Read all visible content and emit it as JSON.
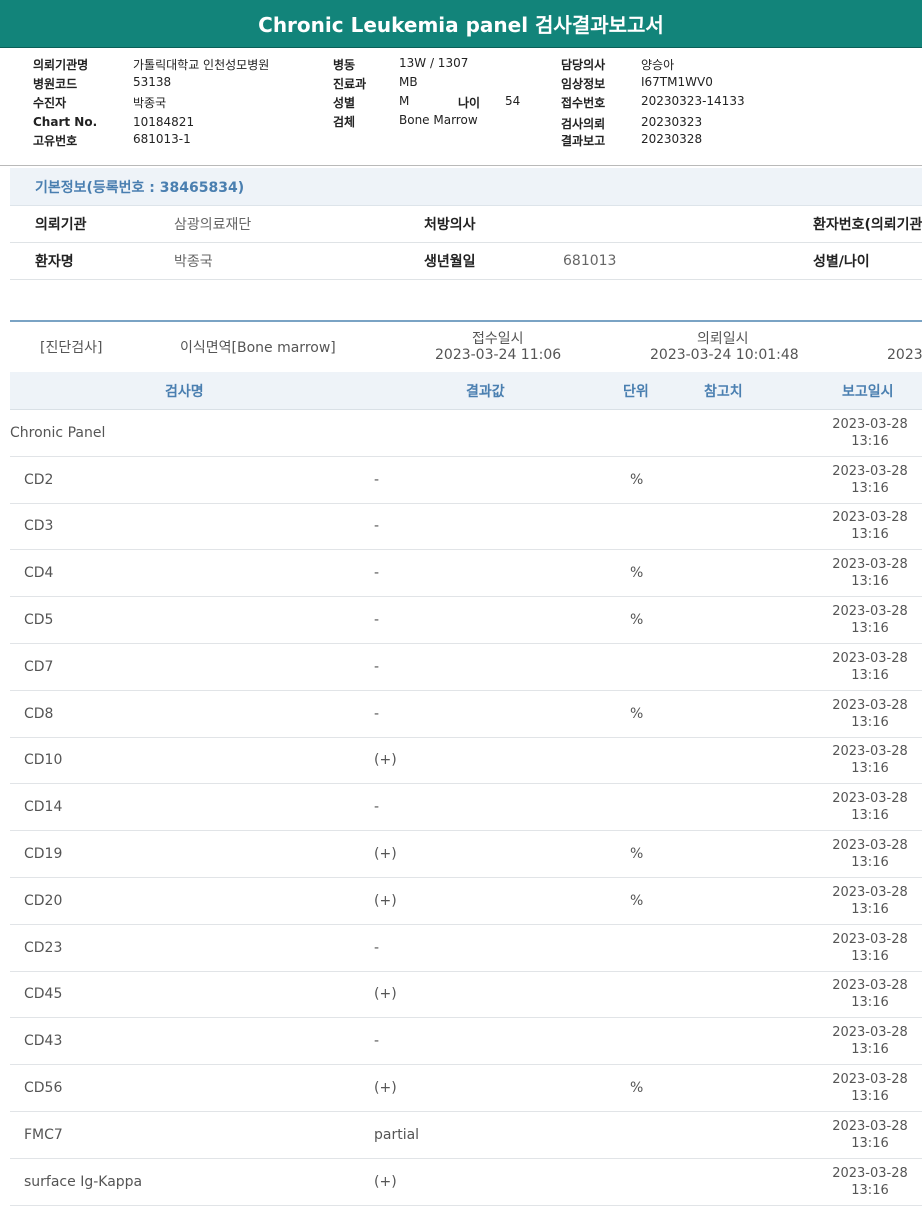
{
  "report": {
    "title": "Chronic Leukemia panel 검사결과보고서"
  },
  "header": {
    "institution_label": "의뢰기관명",
    "institution": "가톨릭대학교 인천성모병원",
    "hospital_code_label": "병원코드",
    "hospital_code": "53138",
    "patient_label": "수진자",
    "patient": "박종국",
    "chart_label": "Chart No.",
    "chart": "10184821",
    "unique_label": "고유번호",
    "unique": "681013-1",
    "ward_label": "병동",
    "ward": "13W / 1307",
    "dept_label": "진료과",
    "dept": "MB",
    "sex_label": "성별",
    "sex": "M",
    "age_label": "나이",
    "age": "54",
    "specimen_label": "검체",
    "specimen": "Bone Marrow",
    "doctor_label": "담당의사",
    "doctor": "양승아",
    "clinical_label": "임상정보",
    "clinical": "I67TM1WV0",
    "receipt_label": "접수번호",
    "receipt": "20230323-14133",
    "request_label": "검사의뢰",
    "request": "20230323",
    "result_label": "결과보고",
    "result": "20230328"
  },
  "basic": {
    "title": "기본정보(등록번호 : 38465834)",
    "row1": {
      "institution_label": "의뢰기관",
      "institution": "삼광의료재단",
      "physician_label": "처방의사",
      "patient_no_label": "환자번호(의뢰기관"
    },
    "row2": {
      "name_label": "환자명",
      "name": "박종국",
      "birth_label": "생년월일",
      "birth": "681013",
      "sex_age_label": "성별/나이"
    }
  },
  "order": {
    "category": "[진단검사]",
    "test": "이식면역[Bone marrow]",
    "received_label": "접수일시",
    "received": "2023-03-24 11:06",
    "requested_label": "의뢰일시",
    "requested": "2023-03-24 10:01:48",
    "cut": "2023"
  },
  "results": {
    "headers": {
      "name": "검사명",
      "value": "결과값",
      "unit": "단위",
      "ref": "참고치",
      "date": "보고일시"
    },
    "rows": [
      {
        "name": "Chronic Panel",
        "value": "",
        "unit": "",
        "ref": "",
        "date": "2023-03-28",
        "time": "13:16"
      },
      {
        "name": "CD2",
        "value": "-",
        "unit": "%",
        "ref": "",
        "date": "2023-03-28",
        "time": "13:16"
      },
      {
        "name": "CD3",
        "value": "-",
        "unit": "",
        "ref": "",
        "date": "2023-03-28",
        "time": "13:16"
      },
      {
        "name": "CD4",
        "value": "-",
        "unit": "%",
        "ref": "",
        "date": "2023-03-28",
        "time": "13:16"
      },
      {
        "name": "CD5",
        "value": "-",
        "unit": "%",
        "ref": "",
        "date": "2023-03-28",
        "time": "13:16"
      },
      {
        "name": "CD7",
        "value": "-",
        "unit": "",
        "ref": "",
        "date": "2023-03-28",
        "time": "13:16"
      },
      {
        "name": "CD8",
        "value": "-",
        "unit": "%",
        "ref": "",
        "date": "2023-03-28",
        "time": "13:16"
      },
      {
        "name": "CD10",
        "value": "(+)",
        "unit": "",
        "ref": "",
        "date": "2023-03-28",
        "time": "13:16"
      },
      {
        "name": "CD14",
        "value": "-",
        "unit": "",
        "ref": "",
        "date": "2023-03-28",
        "time": "13:16"
      },
      {
        "name": "CD19",
        "value": "(+)",
        "unit": "%",
        "ref": "",
        "date": "2023-03-28",
        "time": "13:16"
      },
      {
        "name": "CD20",
        "value": "(+)",
        "unit": "%",
        "ref": "",
        "date": "2023-03-28",
        "time": "13:16"
      },
      {
        "name": "CD23",
        "value": "-",
        "unit": "",
        "ref": "",
        "date": "2023-03-28",
        "time": "13:16"
      },
      {
        "name": "CD45",
        "value": "(+)",
        "unit": "",
        "ref": "",
        "date": "2023-03-28",
        "time": "13:16"
      },
      {
        "name": "CD43",
        "value": "-",
        "unit": "",
        "ref": "",
        "date": "2023-03-28",
        "time": "13:16"
      },
      {
        "name": "CD56",
        "value": "(+)",
        "unit": "%",
        "ref": "",
        "date": "2023-03-28",
        "time": "13:16"
      },
      {
        "name": "FMC7",
        "value": "partial",
        "unit": "",
        "ref": "",
        "date": "2023-03-28",
        "time": "13:16"
      },
      {
        "name": "surface Ig-Kappa",
        "value": "(+)",
        "unit": "",
        "ref": "",
        "date": "2023-03-28",
        "time": "13:16"
      }
    ]
  }
}
